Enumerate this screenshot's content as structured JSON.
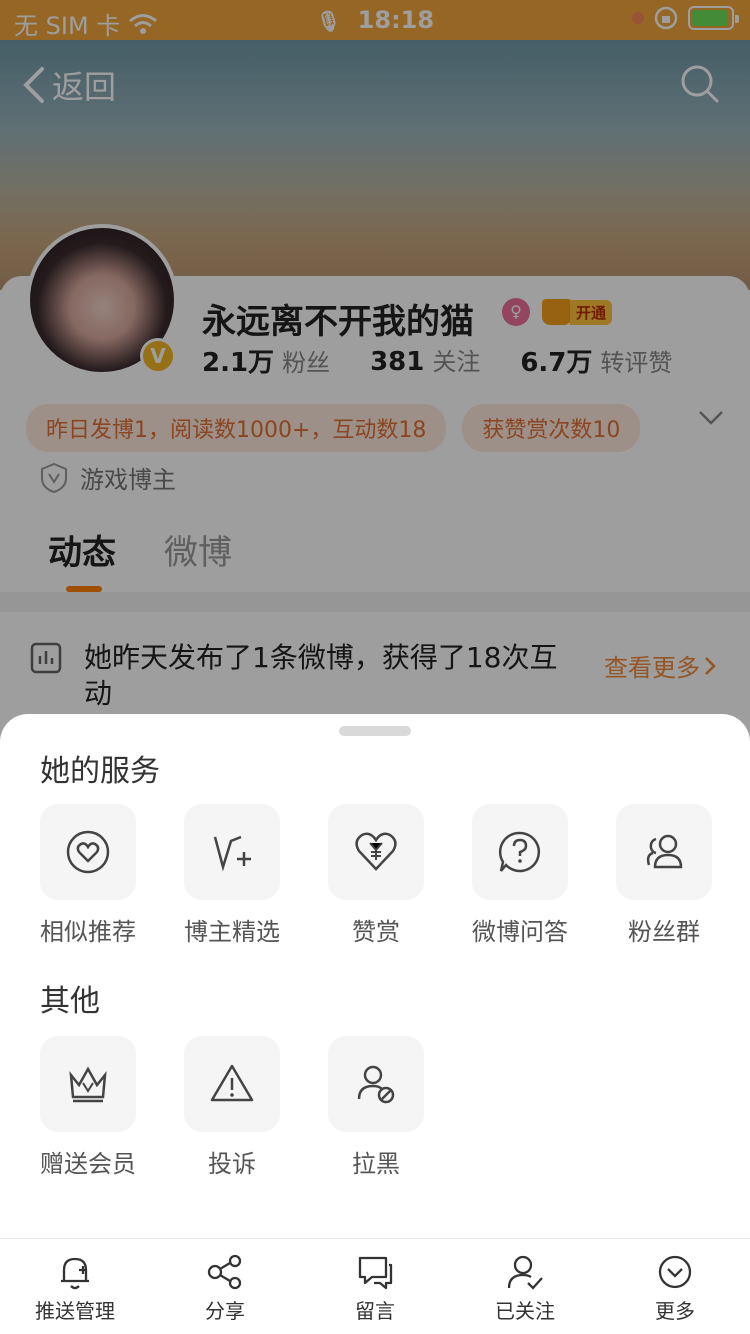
{
  "status_bar": {
    "carrier": "无 SIM 卡",
    "time": "18:18"
  },
  "header": {
    "back_label": "返回"
  },
  "profile": {
    "name": "永远离不开我的猫",
    "vip_label": "开通",
    "stats": [
      {
        "num": "2.1万",
        "label": "粉丝"
      },
      {
        "num": "381",
        "label": "关注"
      },
      {
        "num": "6.7万",
        "label": "转评赞"
      }
    ],
    "tags": [
      "昨日发博1，阅读数1000+，互动数18",
      "获赞赏次数10"
    ],
    "category": "游戏博主"
  },
  "tabs": [
    "动态",
    "微博"
  ],
  "summary": {
    "text": "她昨天发布了1条微博，获得了18次互动",
    "more": "查看更多"
  },
  "sheet": {
    "services_title": "她的服务",
    "services": [
      {
        "label": "相似推荐",
        "icon": "heart-circle-icon"
      },
      {
        "label": "博主精选",
        "icon": "v-plus-icon"
      },
      {
        "label": "赞赏",
        "icon": "heart-yen-icon"
      },
      {
        "label": "微博问答",
        "icon": "question-bubble-icon"
      },
      {
        "label": "粉丝群",
        "icon": "group-icon"
      }
    ],
    "other_title": "其他",
    "other": [
      {
        "label": "赠送会员",
        "icon": "crown-icon"
      },
      {
        "label": "投诉",
        "icon": "warning-icon"
      },
      {
        "label": "拉黑",
        "icon": "block-user-icon"
      }
    ]
  },
  "toolbar": [
    {
      "label": "推送管理",
      "icon": "bell-plus-icon"
    },
    {
      "label": "分享",
      "icon": "share-icon"
    },
    {
      "label": "留言",
      "icon": "message-icon"
    },
    {
      "label": "已关注",
      "icon": "user-check-icon"
    },
    {
      "label": "更多",
      "icon": "chevron-circle-icon"
    }
  ]
}
